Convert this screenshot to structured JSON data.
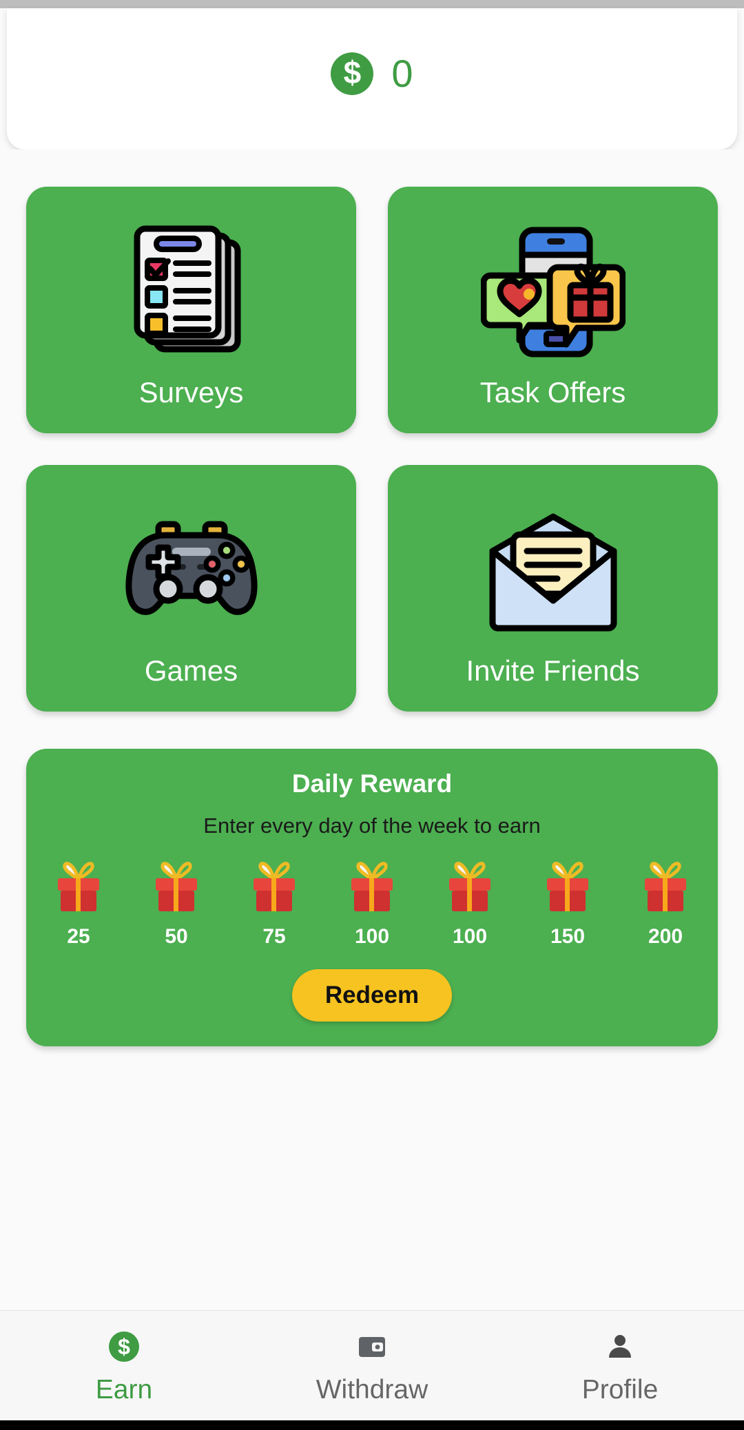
{
  "header": {
    "coin_icon": "dollar-coin-icon",
    "balance": "0",
    "accent_green": "#3f9c43"
  },
  "tiles": [
    {
      "label": "Surveys",
      "icon": "survey-clipboard-icon"
    },
    {
      "label": "Task Offers",
      "icon": "phone-offers-icon"
    },
    {
      "label": "Games",
      "icon": "gamepad-icon"
    },
    {
      "label": "Invite Friends",
      "icon": "open-envelope-icon"
    }
  ],
  "daily_reward": {
    "title": "Daily Reward",
    "subtitle": "Enter every day of the week to earn",
    "gifts": [
      {
        "amount": "25"
      },
      {
        "amount": "50"
      },
      {
        "amount": "75"
      },
      {
        "amount": "100"
      },
      {
        "amount": "100"
      },
      {
        "amount": "150"
      },
      {
        "amount": "200"
      }
    ],
    "redeem_label": "Redeem",
    "card_color": "#4caf50",
    "redeem_color": "#f6c321"
  },
  "bottom_nav": [
    {
      "label": "Earn",
      "icon": "dollar-coin-icon",
      "active": true
    },
    {
      "label": "Withdraw",
      "icon": "wallet-icon",
      "active": false
    },
    {
      "label": "Profile",
      "icon": "person-icon",
      "active": false
    }
  ]
}
